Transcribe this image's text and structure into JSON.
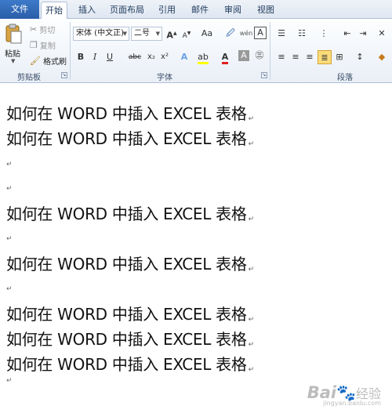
{
  "tabs": [
    "文件",
    "开始",
    "插入",
    "页面布局",
    "引用",
    "邮件",
    "审阅",
    "视图"
  ],
  "clipboard": {
    "paste_label": "粘贴",
    "cut_label": "剪切",
    "copy_label": "复制",
    "format_painter_label": "格式刷",
    "group_label": "剪贴板"
  },
  "font": {
    "font_name": "宋体 (中文正)",
    "font_size": "二号",
    "grow_label": "A",
    "shrink_label": "A",
    "change_case_label": "Aa",
    "bold_label": "B",
    "italic_label": "I",
    "underline_label": "U",
    "strike_label": "abc",
    "subscript_label": "x₂",
    "superscript_label": "x²",
    "group_label": "字体"
  },
  "paragraph": {
    "group_label": "段落"
  },
  "document": {
    "lines": [
      "如何在 WORD 中插入 EXCEL 表格",
      "如何在 WORD 中插入 EXCEL 表格",
      "",
      "",
      "如何在 WORD 中插入 EXCEL 表格",
      "",
      "如何在 WORD 中插入 EXCEL 表格",
      "",
      "如何在 WORD 中插入 EXCEL 表格",
      "如何在 WORD 中插入 EXCEL 表格",
      "如何在 WORD 中插入 EXCEL 表格",
      ""
    ],
    "paragraph_mark": "↵"
  },
  "watermark": {
    "logo_text": "Bai",
    "logo_cn": "经验",
    "sub_text": "jingyan.baidu.com"
  },
  "colors": {
    "file_tab": "#2a5ea8",
    "ribbon_bg": "#e9eff7",
    "highlight": "#fbdc7a"
  }
}
